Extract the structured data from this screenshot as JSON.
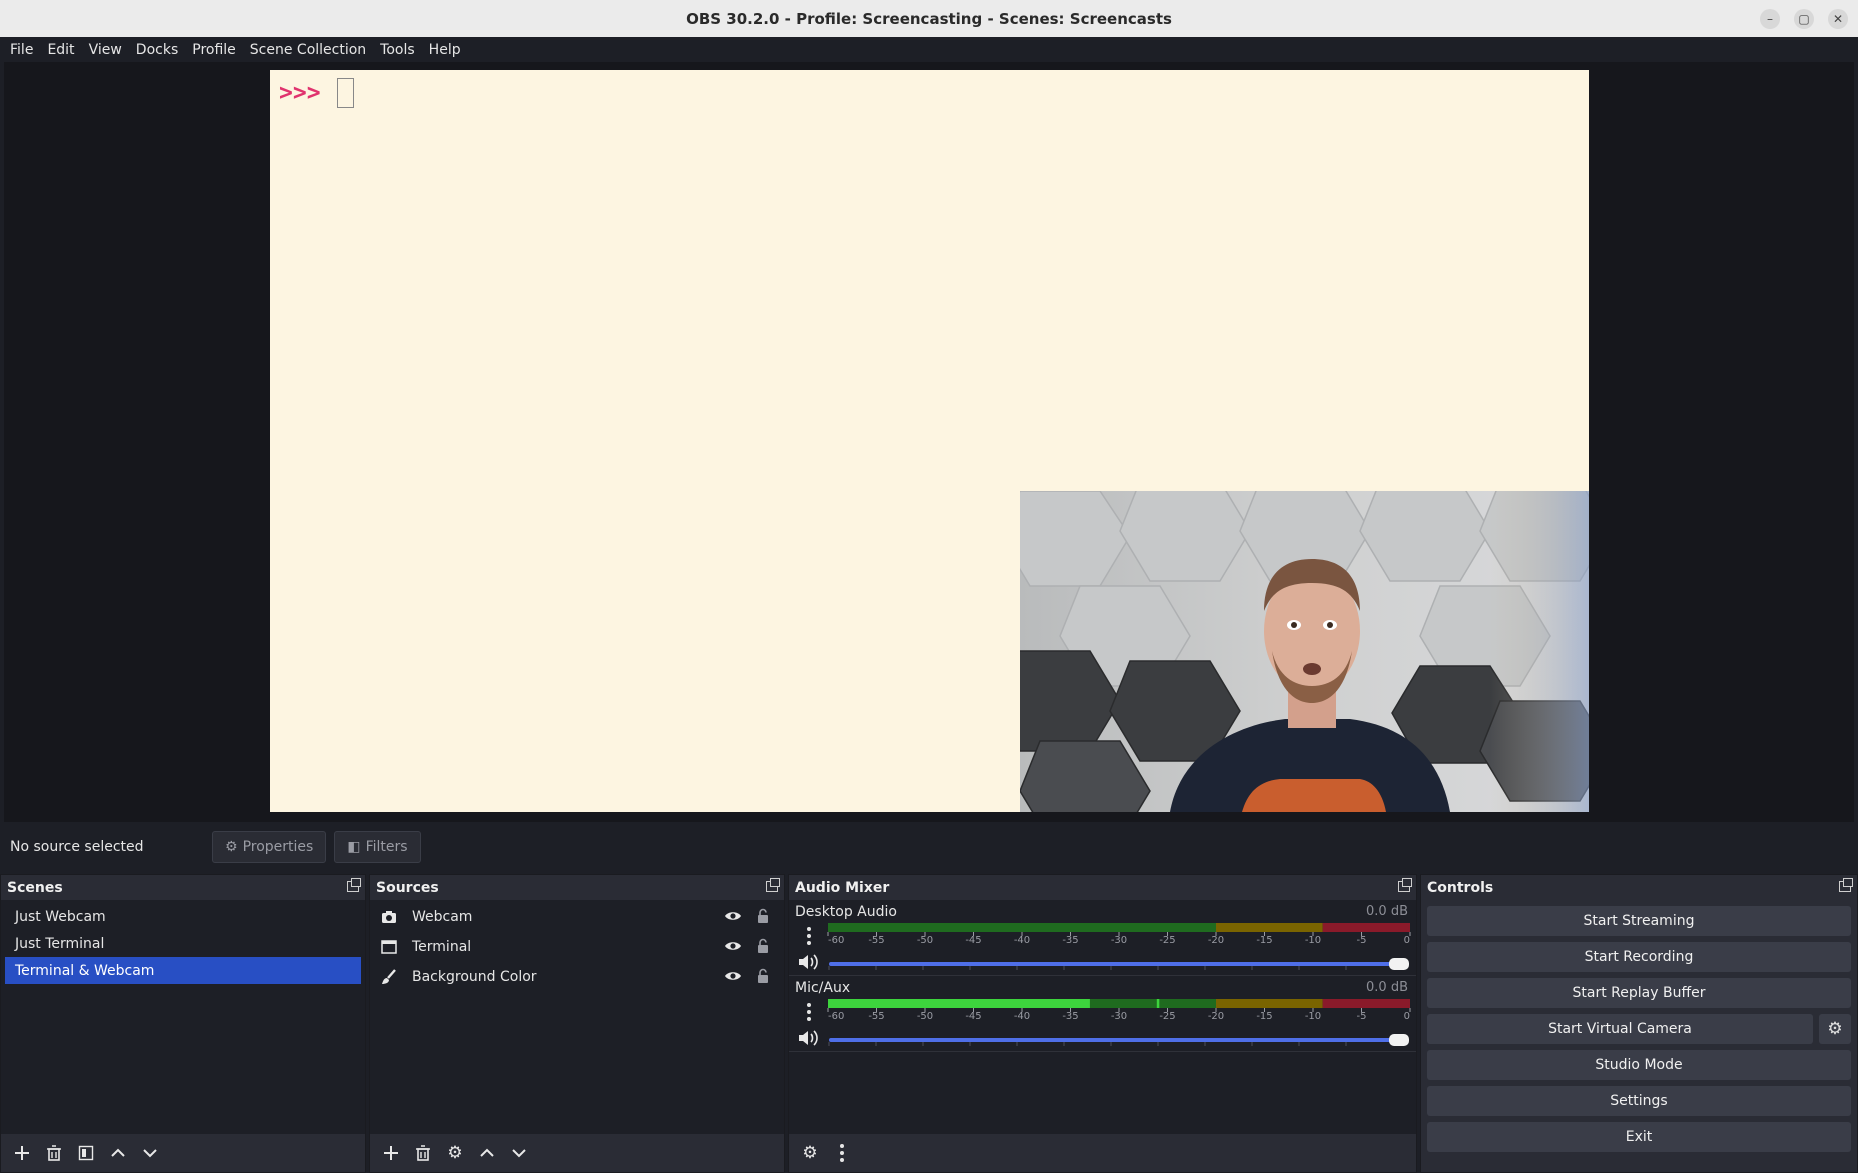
{
  "window": {
    "title": "OBS 30.2.0 - Profile: Screencasting - Scenes: Screencasts"
  },
  "menu": [
    "File",
    "Edit",
    "View",
    "Docks",
    "Profile",
    "Scene Collection",
    "Tools",
    "Help"
  ],
  "preview": {
    "prompt": ">>>"
  },
  "context": {
    "no_source": "No source selected",
    "properties": "Properties",
    "filters": "Filters"
  },
  "scenes": {
    "title": "Scenes",
    "items": [
      "Just Webcam",
      "Just Terminal",
      "Terminal & Webcam"
    ],
    "selected_index": 2
  },
  "sources": {
    "title": "Sources",
    "items": [
      {
        "label": "Webcam",
        "icon": "camera-icon"
      },
      {
        "label": "Terminal",
        "icon": "window-icon"
      },
      {
        "label": "Background Color",
        "icon": "brush-icon"
      }
    ]
  },
  "mixer": {
    "title": "Audio Mixer",
    "scale_labels": [
      "-60",
      "-55",
      "-50",
      "-45",
      "-40",
      "-35",
      "-30",
      "-25",
      "-20",
      "-15",
      "-10",
      "-5",
      "0"
    ],
    "channels": [
      {
        "name": "Desktop Audio",
        "db": "0.0 dB",
        "level_db": -60,
        "volume": 1.0
      },
      {
        "name": "Mic/Aux",
        "db": "0.0 dB",
        "level_db": -33,
        "peak_db": -26,
        "volume": 1.0
      }
    ]
  },
  "controls": {
    "title": "Controls",
    "buttons": [
      "Start Streaming",
      "Start Recording",
      "Start Replay Buffer",
      "Start Virtual Camera",
      "Studio Mode",
      "Settings",
      "Exit"
    ]
  },
  "colors": {
    "selected": "#284fc4",
    "meter_green": "#3dd43d",
    "meter_yellow": "#c8a000",
    "meter_red": "#d6203c",
    "volume_blue": "#4f6fe8",
    "prompt": "#e0336e"
  }
}
